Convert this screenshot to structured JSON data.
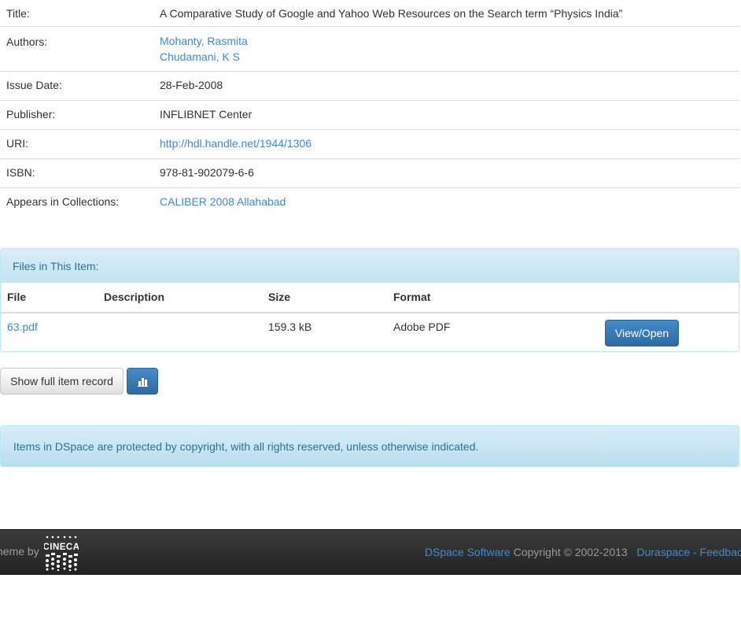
{
  "metadata": [
    {
      "label": "Title:",
      "values": [
        "A Comparative Study of Google and Yahoo Web Resources on the Search term “Physics India”"
      ],
      "link": false
    },
    {
      "label": "Authors:",
      "values": [
        "Mohanty, Rasmita",
        "Chudamani, K S"
      ],
      "link": true
    },
    {
      "label": "Issue Date:",
      "values": [
        "28-Feb-2008"
      ],
      "link": false
    },
    {
      "label": "Publisher:",
      "values": [
        "INFLIBNET Center"
      ],
      "link": false
    },
    {
      "label": "URI:",
      "values": [
        "http://hdl.handle.net/1944/1306"
      ],
      "link": true
    },
    {
      "label": "ISBN:",
      "values": [
        "978-81-902079-6-6"
      ],
      "link": false
    },
    {
      "label": "Appears in Collections:",
      "values": [
        "CALIBER 2008 Allahabad"
      ],
      "link": true
    }
  ],
  "files": {
    "heading": "Files in This Item:",
    "columns": {
      "file": "File",
      "description": "Description",
      "size": "Size",
      "format": "Format"
    },
    "rows": [
      {
        "file": "63.pdf",
        "description": "",
        "size": "159.3 kB",
        "format": "Adobe PDF",
        "action": "View/Open"
      }
    ]
  },
  "buttons": {
    "full_record": "Show full item record",
    "stats_icon": "bar-chart-icon"
  },
  "copyright_notice": "Items in DSpace are protected by copyright, with all rights reserved, unless otherwise indicated.",
  "footer": {
    "theme_by": "heme by",
    "logo": "CINECA",
    "dspace_link": "DSpace Software",
    "copyright": "Copyright © 2002-2013",
    "duraspace_link": "Duraspace",
    "separator": "-",
    "feedback_link": "Feedbac"
  },
  "colors": {
    "link": "#428bca",
    "primary": "#428bca",
    "info_bg": "#d9edf7",
    "info_text": "#31708f",
    "footer_bg": "#222222"
  }
}
